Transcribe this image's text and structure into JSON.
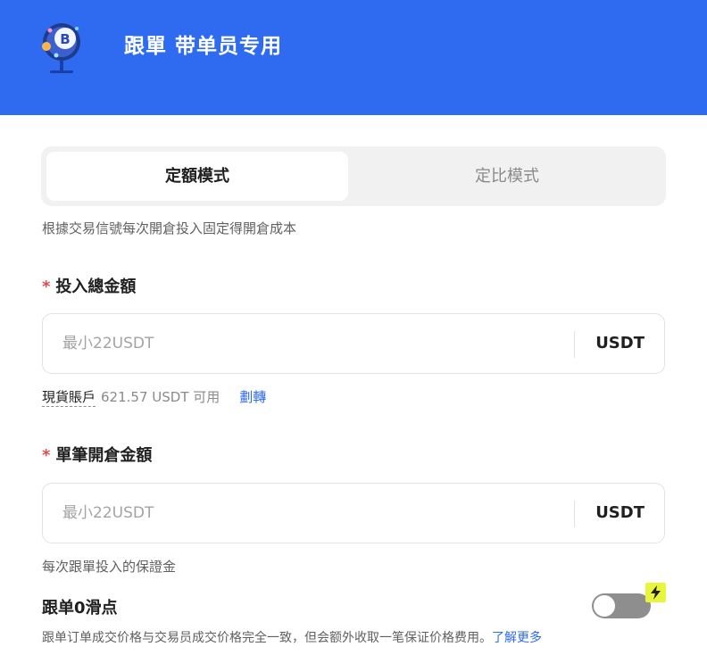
{
  "header": {
    "title": "跟單 带单员专用",
    "logo_icon": "bitcoin-globe-icon",
    "background_color": "#2f6bf0"
  },
  "tabs": [
    {
      "label": "定額模式",
      "selected": true
    },
    {
      "label": "定比模式",
      "selected": false
    }
  ],
  "mode_description": "根據交易信號每次開倉投入固定得開倉成本",
  "total_investment": {
    "required_mark": "*",
    "label": "投入總金額",
    "placeholder": "最小22USDT",
    "value": "",
    "unit": "USDT"
  },
  "balance": {
    "account_label": "現貨賬戶",
    "available_text": "621.57 USDT 可用",
    "transfer_link": "劃轉"
  },
  "single_order": {
    "required_mark": "*",
    "label": "單筆開倉金額",
    "placeholder": "最小22USDT",
    "value": "",
    "unit": "USDT"
  },
  "margin_hint": "每次跟單投入的保證金",
  "zero_slippage": {
    "title": "跟单0滑点",
    "enabled": false,
    "badge_icon": "lightning-bolt-icon",
    "description": "跟单订单成交价格与交易员成交价格完全一致，但会额外收取一笔保证价格费用。",
    "learn_more": "了解更多"
  },
  "colors": {
    "accent": "#2f6bf0",
    "required": "#e5484d",
    "badge": "#e8f53a",
    "toggle_off": "#8e8e8e"
  }
}
